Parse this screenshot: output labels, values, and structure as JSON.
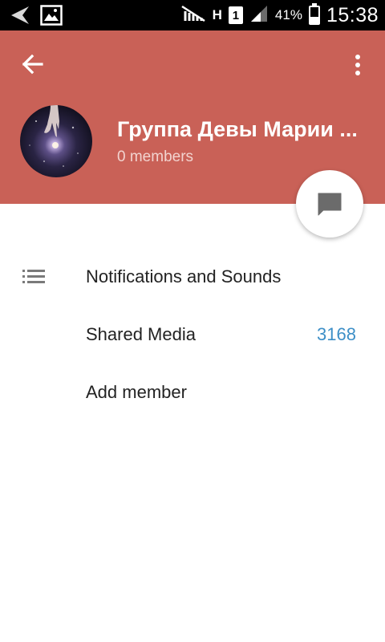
{
  "status_bar": {
    "sim_slot": "1",
    "network_type": "H",
    "battery_percent": "41%",
    "battery_level": 0.41,
    "clock": "15:38"
  },
  "header": {
    "back_icon": "arrow-back-icon",
    "menu_icon": "more-vertical-icon",
    "title": "Группа Девы Марии ...",
    "subtitle": "0 members"
  },
  "fab": {
    "icon": "chat-bubble-icon"
  },
  "list": {
    "notifications_label": "Notifications and Sounds",
    "shared_media_label": "Shared Media",
    "shared_media_count": "3168",
    "add_member_label": "Add member"
  },
  "colors": {
    "header_bg": "#c96157",
    "accent_blue": "#3d8fc7"
  }
}
